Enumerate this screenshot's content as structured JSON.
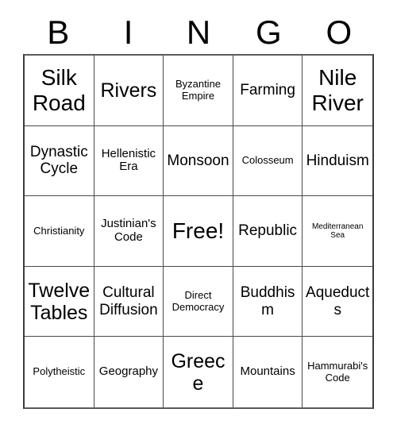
{
  "card": {
    "headers": [
      "B",
      "I",
      "N",
      "G",
      "O"
    ],
    "rows": [
      [
        {
          "text": "Silk Road",
          "size": "xl"
        },
        {
          "text": "Rivers",
          "size": "lg"
        },
        {
          "text": "Byzantine Empire",
          "size": "xs"
        },
        {
          "text": "Farming",
          "size": "md"
        },
        {
          "text": "Nile River",
          "size": "xl"
        }
      ],
      [
        {
          "text": "Dynastic Cycle",
          "size": "md"
        },
        {
          "text": "Hellenistic Era",
          "size": "sm"
        },
        {
          "text": "Monsoon",
          "size": "md"
        },
        {
          "text": "Colosseum",
          "size": "xs"
        },
        {
          "text": "Hinduism",
          "size": "md"
        }
      ],
      [
        {
          "text": "Christianity",
          "size": "xs"
        },
        {
          "text": "Justinian's Code",
          "size": "sm"
        },
        {
          "text": "Free!",
          "size": "xl"
        },
        {
          "text": "Republic",
          "size": "md"
        },
        {
          "text": "Mediterranean Sea",
          "size": "xxs"
        }
      ],
      [
        {
          "text": "Twelve Tables",
          "size": "lg"
        },
        {
          "text": "Cultural Diffusion",
          "size": "md"
        },
        {
          "text": "Direct Democracy",
          "size": "xs"
        },
        {
          "text": "Buddhism",
          "size": "md"
        },
        {
          "text": "Aqueducts",
          "size": "md"
        }
      ],
      [
        {
          "text": "Polytheistic",
          "size": "xs"
        },
        {
          "text": "Geography",
          "size": "sm"
        },
        {
          "text": "Greece",
          "size": "lg"
        },
        {
          "text": "Mountains",
          "size": "sm"
        },
        {
          "text": "Hammurabi's Code",
          "size": "xs"
        }
      ]
    ]
  },
  "colors": {
    "background": "#ffffff",
    "text": "#000000",
    "grid_line": "#4a4a4a"
  }
}
